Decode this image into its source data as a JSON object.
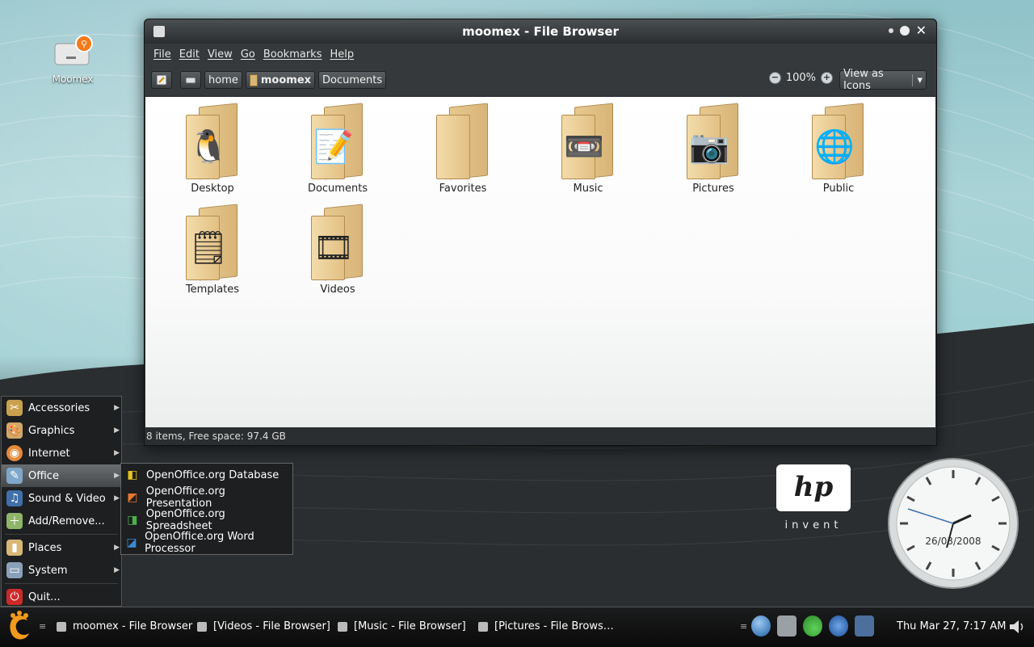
{
  "desktop": {
    "icons": [
      {
        "label": "Moomex",
        "icon": "usb-drive-icon"
      }
    ]
  },
  "window": {
    "title": "moomex - File Browser",
    "menu": [
      "File",
      "Edit",
      "View",
      "Go",
      "Bookmarks",
      "Help"
    ],
    "toolbar": {
      "path": [
        "home",
        "moomex",
        "Documents"
      ],
      "zoom": "100%",
      "view_mode": "View as Icons"
    },
    "items": [
      {
        "label": "Desktop",
        "emblem": "penguin-icon"
      },
      {
        "label": "Documents",
        "emblem": "document-icon"
      },
      {
        "label": "Favorites",
        "emblem": ""
      },
      {
        "label": "Music",
        "emblem": "cassette-icon"
      },
      {
        "label": "Pictures",
        "emblem": "camera-icon"
      },
      {
        "label": "Public",
        "emblem": "globe-icon"
      },
      {
        "label": "Templates",
        "emblem": "note-icon"
      },
      {
        "label": "Videos",
        "emblem": "film-reel-icon"
      }
    ],
    "status": "8 items, Free space: 97.4 GB"
  },
  "menu": {
    "items": [
      {
        "label": "Accessories",
        "icon": "accessories-icon",
        "submenu": true
      },
      {
        "label": "Graphics",
        "icon": "palette-icon",
        "submenu": true
      },
      {
        "label": "Internet",
        "icon": "internet-icon",
        "submenu": true
      },
      {
        "label": "Office",
        "icon": "office-icon",
        "submenu": true
      },
      {
        "label": "Sound & Video",
        "icon": "music-icon",
        "submenu": true
      },
      {
        "label": "Add/Remove...",
        "icon": "add-remove-icon",
        "submenu": false
      },
      {
        "label": "Places",
        "icon": "folder-icon",
        "submenu": true
      },
      {
        "label": "System",
        "icon": "computer-icon",
        "submenu": true
      },
      {
        "label": "Quit...",
        "icon": "power-icon",
        "submenu": false
      }
    ],
    "office_submenu": [
      "OpenOffice.org Database",
      "OpenOffice.org Presentation",
      "OpenOffice.org Spreadsheet",
      "OpenOffice.org Word Processor"
    ]
  },
  "widgets": {
    "hp": {
      "logo": "hp",
      "tagline": "invent"
    },
    "clock_date": "26/03/2008"
  },
  "taskbar": {
    "tasks": [
      "moomex - File Browser",
      "[Videos - File Browser]",
      "[Music - File Browser]",
      "[Pictures - File Brows…"
    ],
    "clock": "Thu Mar 27,  7:17 AM"
  }
}
